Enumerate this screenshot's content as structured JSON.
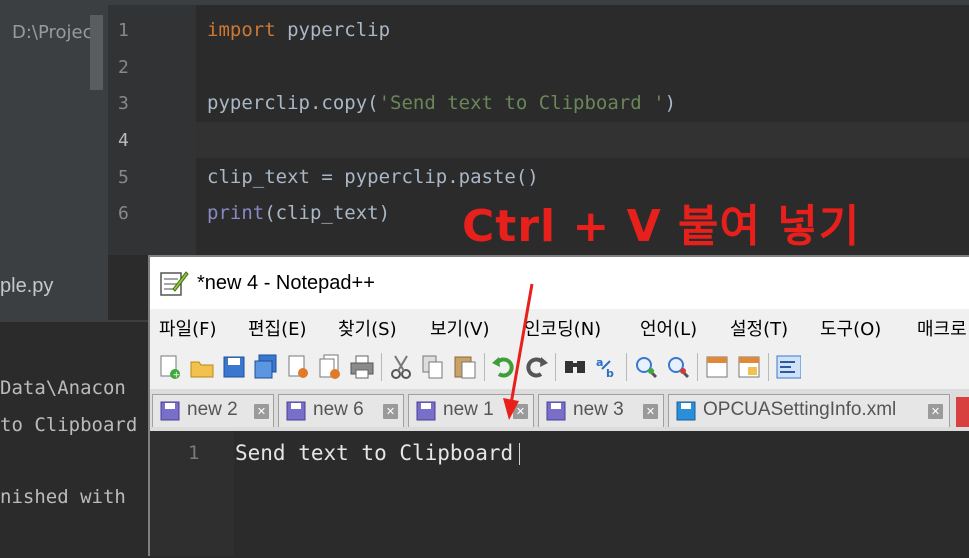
{
  "ide": {
    "project_root": "D:\\Projec",
    "file_name": "ple.py",
    "line_numbers": [
      "1",
      "2",
      "3",
      "4",
      "5",
      "6"
    ],
    "code": {
      "l1_kw": "import",
      "l1_rest": " pyperclip",
      "l3_pre": "pyperclip.copy(",
      "l3_str": "'Send text to Clipboard '",
      "l3_post": ")",
      "l5": "clip_text = pyperclip.paste()",
      "l6_fn": "print",
      "l6_rest": "(clip_text)"
    },
    "run_output": [
      "Data\\Anacon",
      "to Clipboard",
      "nished with"
    ]
  },
  "annotation": "Ctrl + V 붙여 넣기",
  "notepad": {
    "title": "*new 4 - Notepad++",
    "menu": [
      "파일(F)",
      "편집(E)",
      "찾기(S)",
      "보기(V)",
      "인코딩(N)",
      "언어(L)",
      "설정(T)",
      "도구(O)",
      "매크로"
    ],
    "tabs": [
      {
        "label": "new 2",
        "close": "✕"
      },
      {
        "label": "new 6",
        "close": "✕"
      },
      {
        "label": "new 1",
        "close": "✕"
      },
      {
        "label": "new 3",
        "close": "✕"
      },
      {
        "label": "OPCUASettingInfo.xml",
        "close": "✕"
      }
    ],
    "editor": {
      "line_number": "1",
      "text": "Send text to Clipboard"
    },
    "toolbar_icons": [
      "new-file-icon",
      "open-file-icon",
      "save-icon",
      "save-all-icon",
      "close-icon",
      "close-all-icon",
      "print-icon",
      "cut-icon",
      "copy-icon",
      "paste-icon",
      "undo-icon",
      "redo-icon",
      "find-icon",
      "replace-icon",
      "zoom-in-icon",
      "zoom-out-icon",
      "sync-v-icon",
      "sync-h-icon",
      "wrap-icon"
    ]
  },
  "colors": {
    "annotation": "#e8201c",
    "keyword": "#cc7832",
    "string": "#6a8759"
  }
}
